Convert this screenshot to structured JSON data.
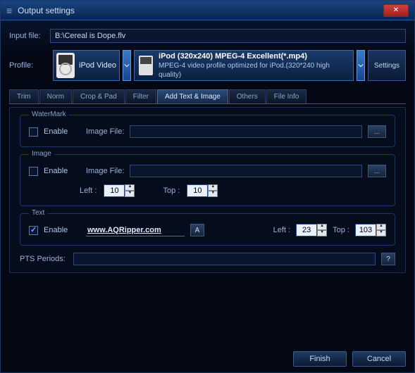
{
  "window": {
    "title": "Output settings"
  },
  "input": {
    "label": "Input file:",
    "value": "B:\\Cereal is Dope.flv"
  },
  "profile": {
    "label": "Profile:",
    "category": "iPod Video",
    "preset_title": "iPod (320x240) MPEG-4 Excellent(*.mp4)",
    "preset_desc": "MPEG-4 video profile optimized for iPod.(320*240 high quality)",
    "settings_btn": "Settings"
  },
  "tabs": [
    {
      "label": "Trim"
    },
    {
      "label": "Norm"
    },
    {
      "label": "Crop & Pad"
    },
    {
      "label": "Filter"
    },
    {
      "label": "Add Text & Image",
      "active": true
    },
    {
      "label": "Others"
    },
    {
      "label": "File Info"
    }
  ],
  "watermark": {
    "legend": "WaterMark",
    "enable_label": "Enable",
    "enabled": false,
    "image_file_label": "Image File:",
    "image_file": ""
  },
  "image": {
    "legend": "Image",
    "enable_label": "Enable",
    "enabled": false,
    "image_file_label": "Image File:",
    "image_file": "",
    "left_label": "Left :",
    "left_value": "10",
    "top_label": "Top :",
    "top_value": "10"
  },
  "text": {
    "legend": "Text",
    "enable_label": "Enable",
    "enabled": true,
    "value": "www.AQRipper.com",
    "font_btn": "A",
    "left_label": "Left :",
    "left_value": "23",
    "top_label": "Top :",
    "top_value": "103"
  },
  "pts": {
    "label": "PTS Periods:",
    "value": "",
    "help": "?"
  },
  "buttons": {
    "finish": "Finish",
    "cancel": "Cancel"
  },
  "browse": "..."
}
